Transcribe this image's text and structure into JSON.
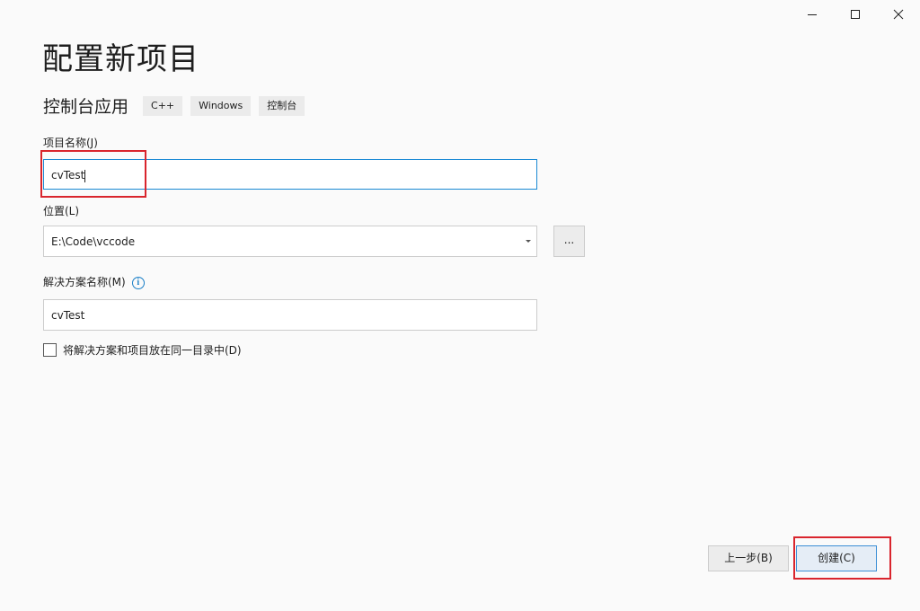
{
  "window": {
    "minimize_icon": "minimize-icon",
    "maximize_icon": "maximize-icon",
    "close_icon": "close-icon"
  },
  "page": {
    "title": "配置新项目"
  },
  "template": {
    "name": "控制台应用",
    "tags": [
      "C++",
      "Windows",
      "控制台"
    ]
  },
  "project_name": {
    "label": "项目名称(J)",
    "value": "cvTest"
  },
  "location": {
    "label": "位置(L)",
    "value": "E:\\Code\\vccode",
    "browse_label": "..."
  },
  "solution_name": {
    "label": "解决方案名称(M)",
    "info_icon": "info-icon",
    "info_glyph": "i",
    "value": "cvTest"
  },
  "same_directory": {
    "label": "将解决方案和项目放在同一目录中(D)",
    "checked": false
  },
  "footer": {
    "back_label": "上一步(B)",
    "create_label": "创建(C)"
  },
  "colors": {
    "accent": "#1a8ad4",
    "highlight": "#d9252d",
    "background": "#fafafa"
  }
}
